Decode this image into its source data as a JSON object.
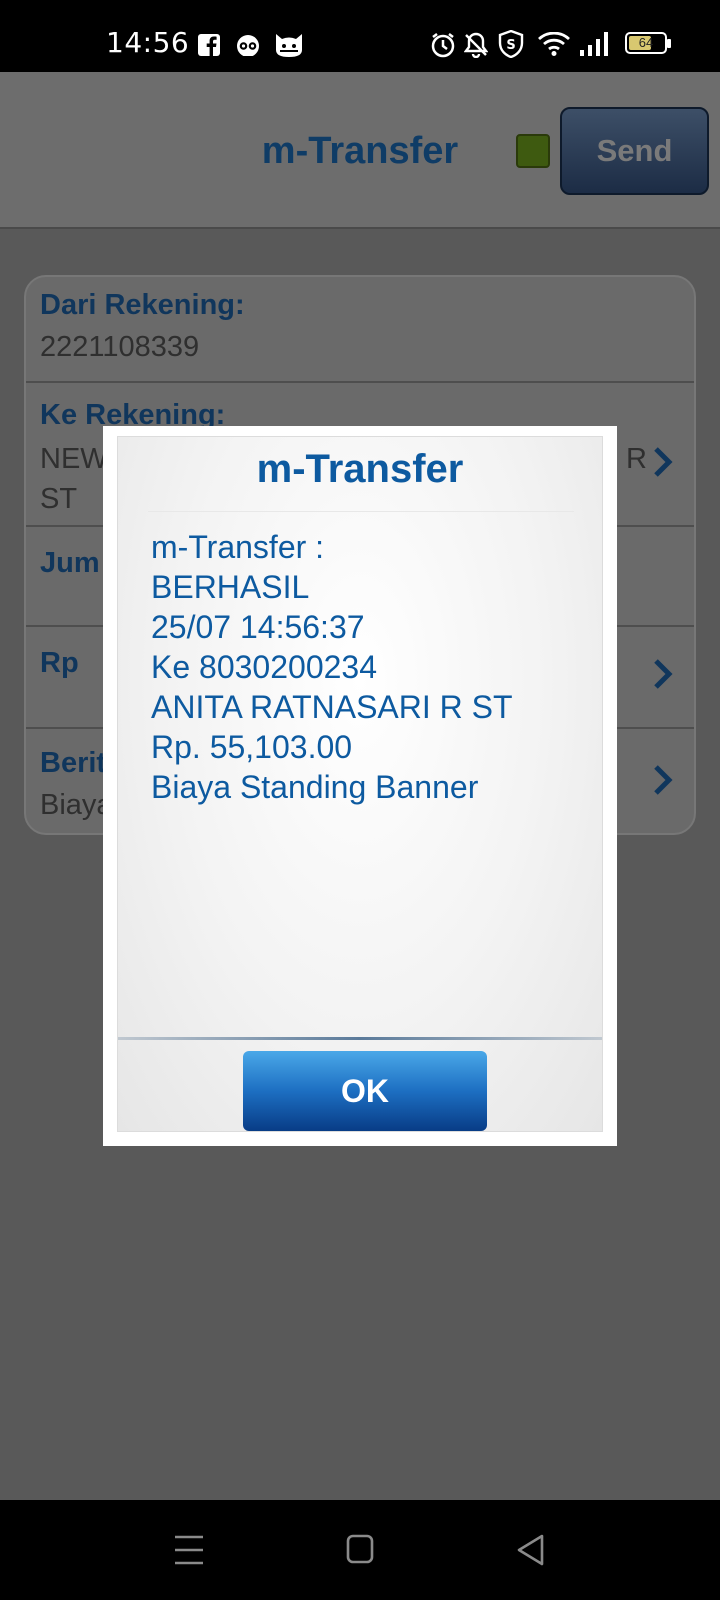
{
  "status_bar": {
    "time": "14:56",
    "battery_level": "64",
    "battery_fraction": 0.64,
    "icons": [
      "facebook-icon",
      "tripadvisor-icon",
      "cat-face-icon",
      "alarm-icon",
      "bell-off-icon",
      "shield-s-icon",
      "wifi-icon",
      "signal-icon",
      "battery-icon"
    ]
  },
  "header": {
    "title": "m-Transfer",
    "send_label": "Send",
    "status_color": "#3e5a10"
  },
  "form": {
    "from_label": "Dari Rekening:",
    "from_value": "2221108339",
    "to_label": "Ke Rekening:",
    "to_value_line1": "NEW",
    "to_value_end": "R",
    "to_value_line2": "ST",
    "amount_label": "Jum",
    "currency_label": "Rp",
    "message_label": "Berit",
    "message_value": "Biaya"
  },
  "dialog": {
    "title": "m-Transfer",
    "lines": [
      "m-Transfer :",
      "BERHASIL",
      "25/07 14:56:37",
      "Ke 8030200234",
      "ANITA RATNASARI R ST",
      "Rp. 55,103.00",
      "Biaya Standing Banner"
    ],
    "ok_label": "OK"
  },
  "nav_bar": {
    "icons": [
      "menu-icon",
      "home-icon",
      "back-icon"
    ]
  },
  "colors": {
    "accent": "#0d5aa0",
    "label": "#10365c",
    "button_top": "#4aa8e8",
    "button_bottom": "#083c86"
  }
}
